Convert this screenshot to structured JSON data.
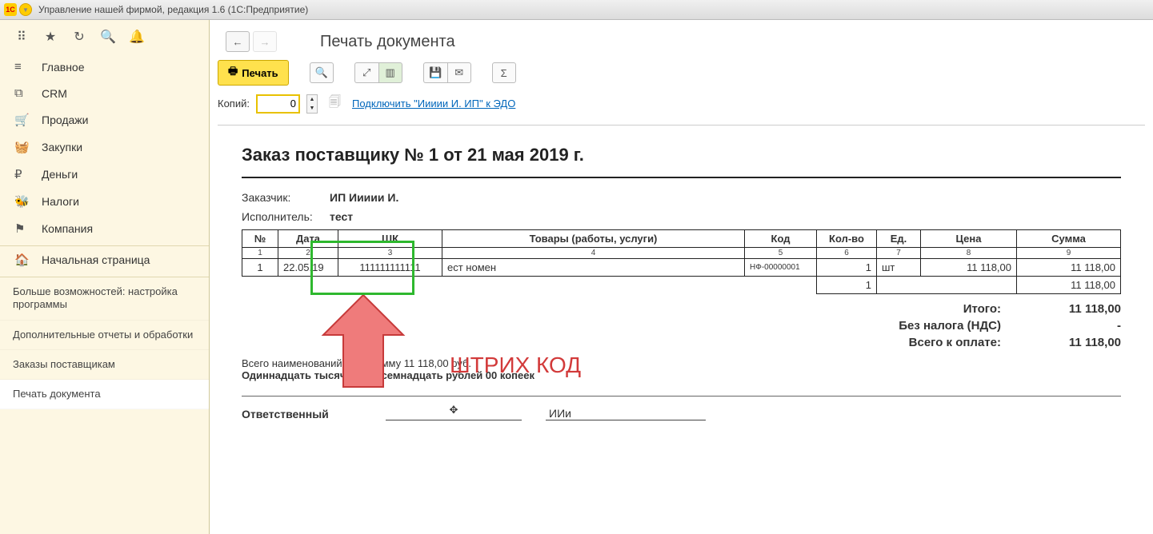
{
  "titlebar": {
    "title": "Управление нашей фирмой, редакция 1.6  (1С:Предприятие)"
  },
  "sidebar": {
    "items": [
      {
        "icon": "≡",
        "label": "Главное"
      },
      {
        "icon": "⧉",
        "label": "CRM"
      },
      {
        "icon": "🛒",
        "label": "Продажи"
      },
      {
        "icon": "🧺",
        "label": "Закупки"
      },
      {
        "icon": "₽",
        "label": "Деньги"
      },
      {
        "icon": "🐝",
        "label": "Налоги"
      },
      {
        "icon": "⚑",
        "label": "Компания"
      }
    ],
    "home": "Начальная страница",
    "subitems": [
      "Больше возможностей: настройка программы",
      "Дополнительные отчеты и обработки",
      "Заказы поставщикам",
      "Печать документа"
    ]
  },
  "page": {
    "title": "Печать документа"
  },
  "toolbar": {
    "print_label": "Печать"
  },
  "copies": {
    "label": "Копий:",
    "value": "0",
    "edo_link": "Подключить \"Иииии И. ИП\" к ЭДО"
  },
  "doc": {
    "title": "Заказ поставщику № 1 от 21 мая 2019 г.",
    "customer_label": "Заказчик:",
    "customer_value": "ИП Иииии И.",
    "executor_label": "Исполнитель:",
    "executor_value": "тест",
    "headers": [
      "№",
      "Дата",
      "ШК",
      "Товары (работы, услуги)",
      "Код",
      "Кол-во",
      "Ед.",
      "Цена",
      "Сумма"
    ],
    "idx": [
      "1",
      "2",
      "3",
      "4",
      "5",
      "6",
      "7",
      "8",
      "9"
    ],
    "row": {
      "n": "1",
      "date": "22.05.19",
      "bc": "111111111111",
      "goods": "ест номен",
      "code": "НФ-00000001",
      "qty": "1",
      "unit": "шт",
      "price": "11 118,00",
      "sum": "11 118,00"
    },
    "total_qty": "1",
    "total_sum": "11 118,00",
    "totals": [
      {
        "label": "Итого:",
        "value": "11 118,00"
      },
      {
        "label": "Без налога (НДС)",
        "value": "-"
      },
      {
        "label": "Всего к оплате:",
        "value": "11 118,00"
      }
    ],
    "summary1": "Всего наименований 1, на сумму 11 118,00 руб.",
    "summary2": "Одиннадцать тысяч сто восемнадцать рублей 00 копеек",
    "responsible_label": "Ответственный",
    "responsible_name": "ИИи"
  },
  "annotation": {
    "label": "ШТРИХ КОД"
  }
}
